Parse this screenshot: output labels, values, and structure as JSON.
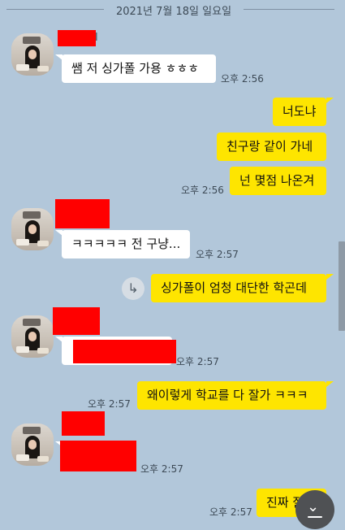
{
  "chat": {
    "date_divider": "2021년 7월 18일 일요일",
    "messages": [
      {
        "id": 1,
        "side": "in",
        "text": "쌤 저 싱가폴 가용 ㅎㅎㅎ",
        "time": "오후 2:56",
        "name_suffix": "l"
      },
      {
        "id": 2,
        "side": "out",
        "text": "너도냐"
      },
      {
        "id": 3,
        "side": "out",
        "text": "친구랑 같이 가네"
      },
      {
        "id": 4,
        "side": "out",
        "text": "넌 몇점 나온겨",
        "time": "오후 2:56"
      },
      {
        "id": 5,
        "side": "in",
        "text": "ㅋㅋㅋㅋㅋ 전 구냥...",
        "time": "오후 2:57"
      },
      {
        "id": 6,
        "side": "out",
        "text": "싱가폴이 엄청 대단한 학곤데",
        "share_icon": "share-arrow-icon"
      },
      {
        "id": 7,
        "side": "in",
        "text": "",
        "time": "오후 2:57",
        "redacted": true
      },
      {
        "id": 8,
        "side": "out",
        "text": "왜이렇게 학교를 다 잘가 ㅋㅋㅋ",
        "time": "오후 2:57"
      },
      {
        "id": 9,
        "side": "in",
        "text": "",
        "time": "오후 2:57",
        "redacted": true
      },
      {
        "id": 10,
        "side": "out",
        "text": "진짜 잘",
        "time": "오후 2:57"
      }
    ]
  },
  "controls": {
    "scroll_down_icon": "chevron-down-icon",
    "scroll_down_glyph": "⌄"
  },
  "colors": {
    "background": "#b2c7da",
    "my_bubble": "#fee500",
    "their_bubble": "#ffffff",
    "redaction": "#ff0000"
  }
}
